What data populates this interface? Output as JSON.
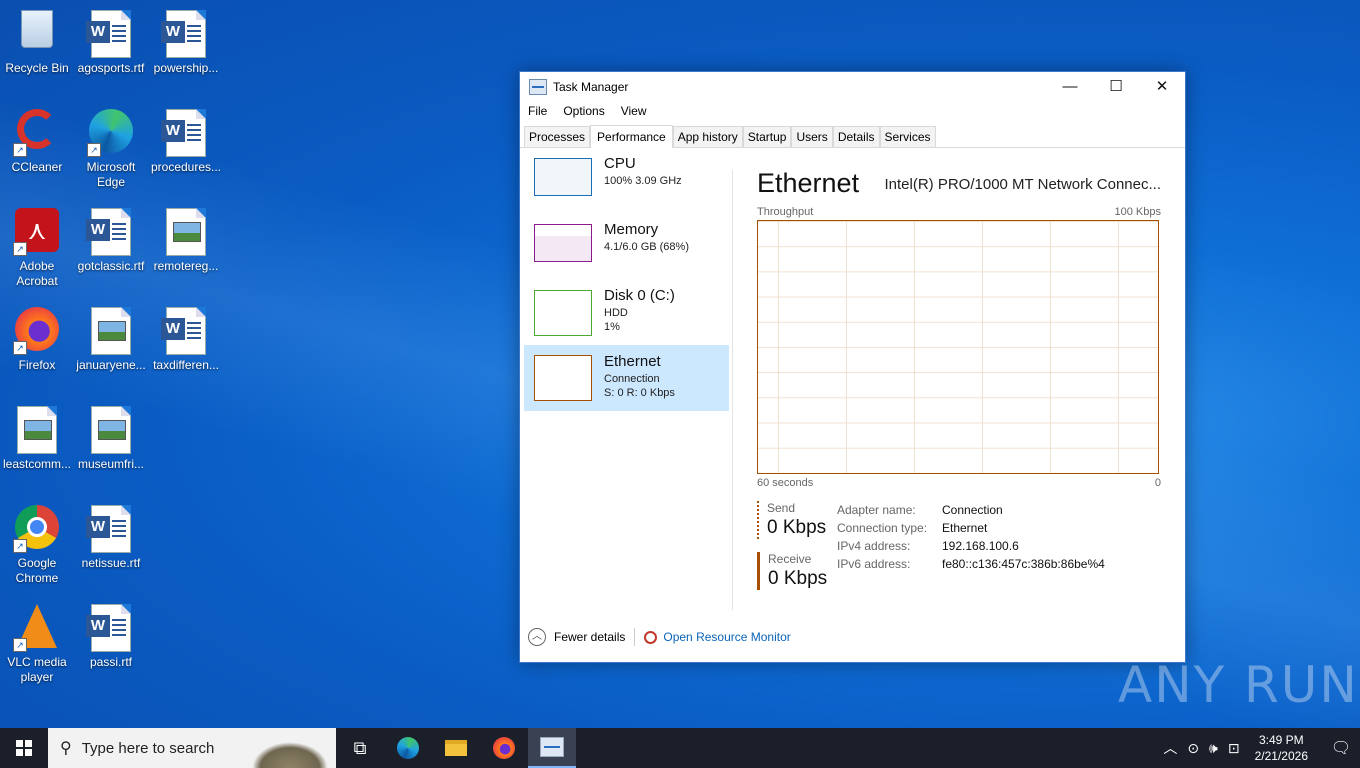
{
  "desktop": {
    "icons": [
      {
        "label": "Recycle Bin",
        "icon": "recycle-bin-icon"
      },
      {
        "label": "agosports.rtf",
        "icon": "word-document-icon"
      },
      {
        "label": "powership...",
        "icon": "word-document-icon"
      },
      {
        "label": "CCleaner",
        "icon": "ccleaner-icon"
      },
      {
        "label": "Microsoft Edge",
        "icon": "edge-icon"
      },
      {
        "label": "procedures...",
        "icon": "word-document-icon"
      },
      {
        "label": "Adobe Acrobat",
        "icon": "acrobat-icon"
      },
      {
        "label": "gotclassic.rtf",
        "icon": "word-document-icon"
      },
      {
        "label": "remotereg...",
        "icon": "image-file-icon"
      },
      {
        "label": "Firefox",
        "icon": "firefox-icon"
      },
      {
        "label": "januaryene...",
        "icon": "image-file-icon"
      },
      {
        "label": "taxdifferen...",
        "icon": "word-document-icon"
      },
      {
        "label": "leastcomm...",
        "icon": "image-file-icon"
      },
      {
        "label": "museumfri...",
        "icon": "image-file-icon"
      },
      {
        "label": "Google Chrome",
        "icon": "chrome-icon"
      },
      {
        "label": "netissue.rtf",
        "icon": "word-document-icon"
      },
      {
        "label": "VLC media player",
        "icon": "vlc-icon"
      },
      {
        "label": "passi.rtf",
        "icon": "word-document-icon"
      }
    ]
  },
  "taskmanager": {
    "title": "Task Manager",
    "window_buttons": {
      "minimize": "—",
      "maximize": "☐",
      "close": "✕"
    },
    "menu": [
      "File",
      "Options",
      "View"
    ],
    "tabs": [
      "Processes",
      "Performance",
      "App history",
      "Startup",
      "Users",
      "Details",
      "Services"
    ],
    "active_tab": "Performance",
    "resources": [
      {
        "title": "CPU",
        "line1": "100%  3.09 GHz",
        "line2": "",
        "color": "#1a6fb4"
      },
      {
        "title": "Memory",
        "line1": "4.1/6.0 GB (68%)",
        "line2": "",
        "color": "#8b1a8b"
      },
      {
        "title": "Disk 0 (C:)",
        "line1": "HDD",
        "line2": "1%",
        "color": "#4ea72e"
      },
      {
        "title": "Ethernet",
        "line1": "Connection",
        "line2": "S: 0  R: 0 Kbps",
        "color": "#a74f01"
      }
    ],
    "selected_resource": "Ethernet",
    "detail": {
      "title": "Ethernet",
      "adapter": "Intel(R) PRO/1000 MT Network Connec...",
      "graph_label_left": "Throughput",
      "graph_label_right": "100 Kbps",
      "graph_foot_left": "60 seconds",
      "graph_foot_right": "0",
      "send_label": "Send",
      "send_value": "0 Kbps",
      "receive_label": "Receive",
      "receive_value": "0 Kbps",
      "properties": [
        {
          "key": "Adapter name:",
          "value": "Connection"
        },
        {
          "key": "Connection type:",
          "value": "Ethernet"
        },
        {
          "key": "IPv4 address:",
          "value": "192.168.100.6"
        },
        {
          "key": "IPv6 address:",
          "value": "fe80::c136:457c:386b:86be%4"
        }
      ]
    },
    "footer": {
      "fewer_details": "Fewer details",
      "resource_monitor": "Open Resource Monitor"
    }
  },
  "taskbar": {
    "search_placeholder": "Type here to search",
    "apps": [
      "task-view-icon",
      "edge-icon",
      "file-explorer-icon",
      "firefox-icon",
      "task-manager-icon"
    ],
    "time": "3:49 PM",
    "date": "2/21/2026"
  },
  "watermark": "ANY RUN"
}
